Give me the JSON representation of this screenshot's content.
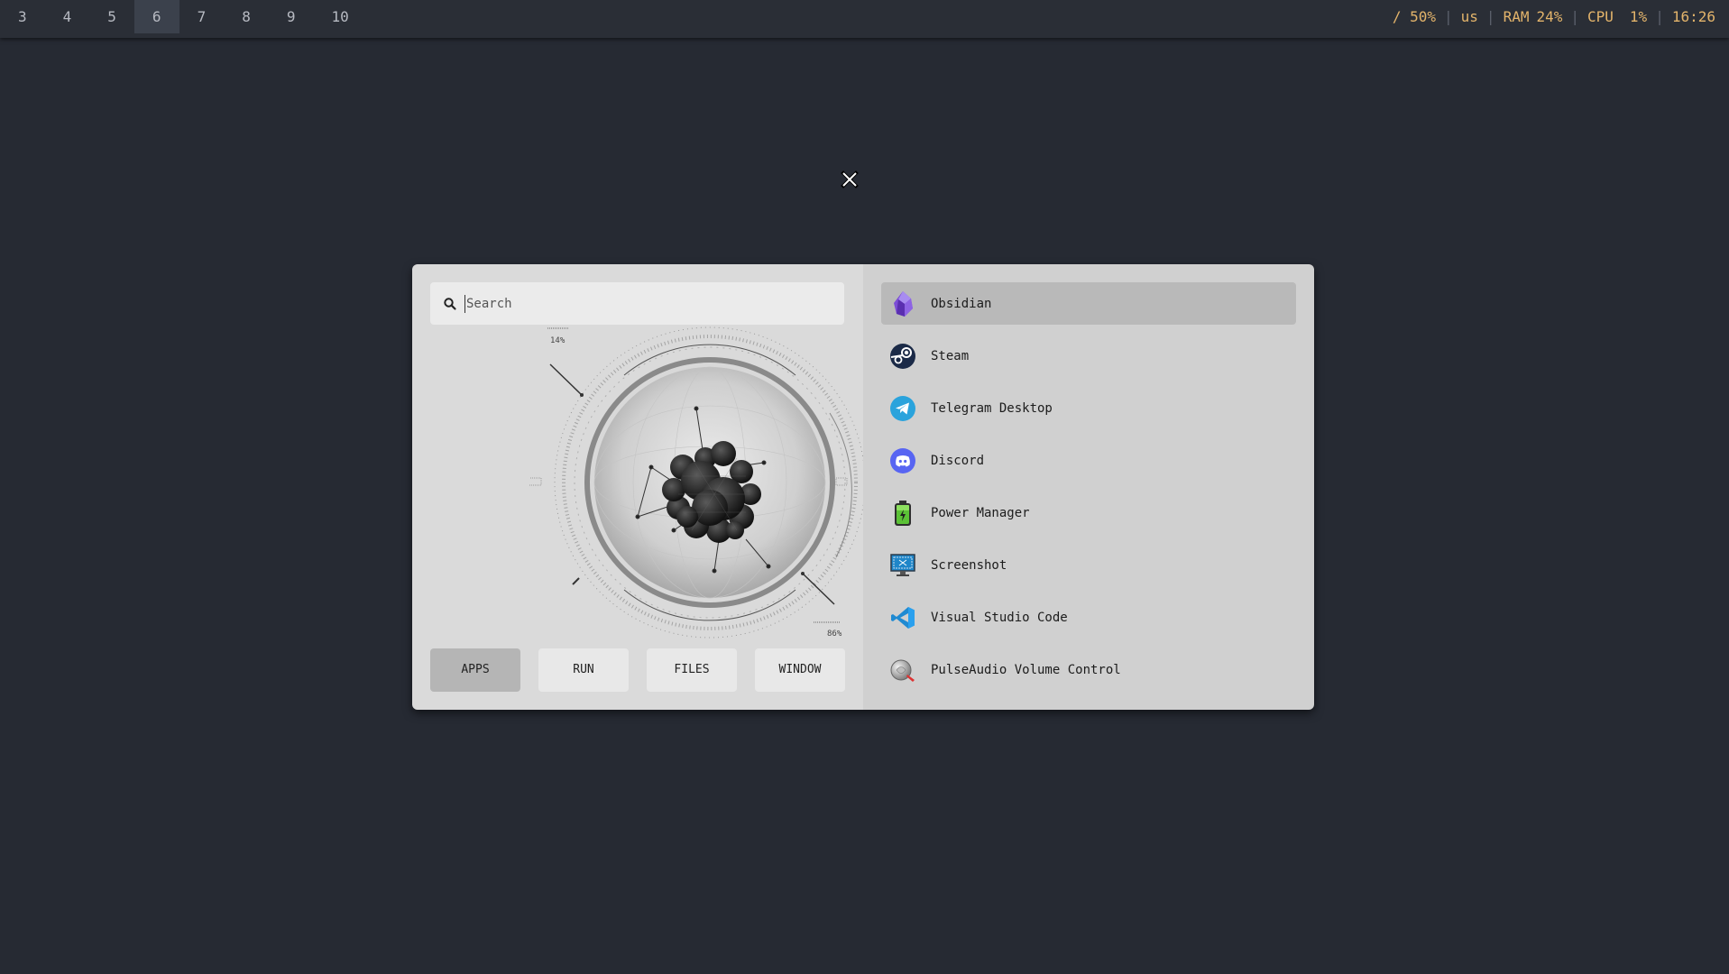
{
  "topbar": {
    "workspaces": [
      "3",
      "4",
      "5",
      "6",
      "7",
      "8",
      "9",
      "10"
    ],
    "active_workspace": "6",
    "disk": "/ 50%",
    "layout": "us",
    "ram_label": "RAM",
    "ram_value": "24%",
    "cpu_label": "CPU",
    "cpu_value": "1%",
    "clock": "16:26",
    "separator": "|"
  },
  "launcher": {
    "search": {
      "placeholder": "Search",
      "value": ""
    },
    "visual": {
      "top_percent": "14%",
      "bottom_percent": "86%"
    },
    "modes": [
      {
        "label": "APPS",
        "active": true
      },
      {
        "label": "RUN",
        "active": false
      },
      {
        "label": "FILES",
        "active": false
      },
      {
        "label": "WINDOW",
        "active": false
      }
    ],
    "apps": [
      {
        "label": "Obsidian",
        "icon": "obsidian-icon",
        "selected": true
      },
      {
        "label": "Steam",
        "icon": "steam-icon"
      },
      {
        "label": "Telegram Desktop",
        "icon": "telegram-icon"
      },
      {
        "label": "Discord",
        "icon": "discord-icon"
      },
      {
        "label": "Power Manager",
        "icon": "battery-icon"
      },
      {
        "label": "Screenshot",
        "icon": "screenshot-icon"
      },
      {
        "label": "Visual Studio Code",
        "icon": "vscode-icon"
      },
      {
        "label": "PulseAudio Volume Control",
        "icon": "volume-control-icon"
      }
    ]
  },
  "colors": {
    "desktop_bg": "#262a33",
    "bar_bg": "#2a2e36",
    "accent_yellow": "#e3b46b",
    "left_pane": "#dadada",
    "right_pane": "#d0d0d0",
    "selected_item": "#b9b9b9"
  }
}
